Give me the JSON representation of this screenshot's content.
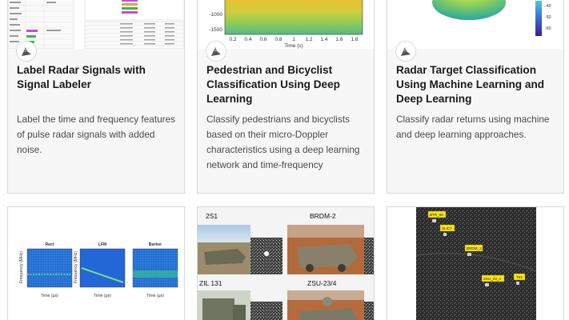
{
  "cards": [
    {
      "title": "Label Radar Signals with Signal Labeler",
      "description": "Label the time and frequency features of pulse radar signals with added noise.",
      "badge_icon": "radar-product-icon"
    },
    {
      "title": "Pedestrian and Bicyclist Classification Using Deep Learning",
      "description": "Classify pedestrians and bicyclists based on their micro-Doppler characteristics using a deep learning network and time-frequency",
      "badge_icon": "radar-product-icon",
      "thumb": {
        "y_ticks": [
          "-1000",
          "-1500"
        ],
        "x_ticks": [
          "0.2",
          "0.4",
          "0.6",
          "0.8",
          "1",
          "1.2",
          "1.4",
          "1.6",
          "1.8"
        ],
        "x_label": "Time (s)"
      }
    },
    {
      "title": "Radar Target Classification Using Machine Learning and Deep Learning",
      "description": "Classify radar returns using machine and deep learning approaches.",
      "badge_icon": "radar-product-icon",
      "thumb": {
        "colorbar_ticks": [
          "-40",
          "-50",
          "-60"
        ]
      }
    },
    {
      "thumb": {
        "panels": [
          "Rect",
          "LFM",
          "Barker"
        ],
        "y_label": "Frequency (MHz)",
        "x_label": "Time (μs)"
      }
    },
    {
      "thumb": {
        "vehicles": [
          "2S1",
          "BRDM-2",
          "ZIL 131",
          "ZSU-23/4"
        ]
      }
    },
    {
      "thumb": {
        "targets": [
          "BTR_60",
          "SLICY",
          "BRDM_2",
          "ZSU_23_4",
          "T62"
        ]
      }
    }
  ],
  "colors": {
    "card_bg": "#f7f7f7",
    "card_border": "#d8d8d8",
    "title": "#1a1a1a",
    "description": "#4a4a4a",
    "spectrogram_accent": "#f4c430",
    "target_label": "#ffe600"
  }
}
